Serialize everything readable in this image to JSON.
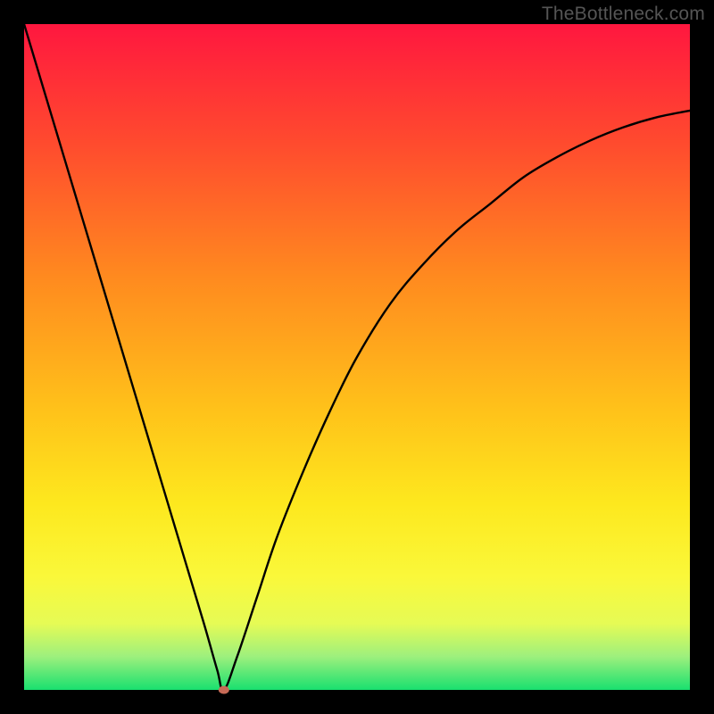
{
  "watermark": {
    "text": "TheBottleneck.com"
  },
  "colors": {
    "frame": "#000000",
    "gradient_stops": [
      {
        "pct": 0,
        "color": "#ff173f"
      },
      {
        "pct": 18,
        "color": "#ff4b2e"
      },
      {
        "pct": 38,
        "color": "#ff8a1f"
      },
      {
        "pct": 58,
        "color": "#ffc21a"
      },
      {
        "pct": 72,
        "color": "#fde81e"
      },
      {
        "pct": 83,
        "color": "#faf83a"
      },
      {
        "pct": 90,
        "color": "#e6fb55"
      },
      {
        "pct": 95,
        "color": "#9df07d"
      },
      {
        "pct": 100,
        "color": "#19e06f"
      }
    ],
    "curve": "#000000",
    "marker": "#c76a56"
  },
  "chart_data": {
    "type": "line",
    "title": "",
    "xlabel": "",
    "ylabel": "",
    "xlim": [
      0,
      100
    ],
    "ylim": [
      0,
      100
    ],
    "annotations": [
      "TheBottleneck.com"
    ],
    "series": [
      {
        "name": "bottleneck-curve",
        "x": [
          0,
          3,
          6,
          9,
          12,
          15,
          18,
          21,
          24,
          27,
          29,
          30,
          32,
          35,
          38,
          42,
          46,
          50,
          55,
          60,
          65,
          70,
          75,
          80,
          85,
          90,
          95,
          100
        ],
        "values": [
          100,
          90,
          80,
          70,
          60,
          50,
          40,
          30,
          20,
          10,
          3,
          0,
          5,
          14,
          23,
          33,
          42,
          50,
          58,
          64,
          69,
          73,
          77,
          80,
          82.5,
          84.5,
          86,
          87
        ]
      }
    ],
    "marker": {
      "x": 30,
      "y": 0
    }
  }
}
